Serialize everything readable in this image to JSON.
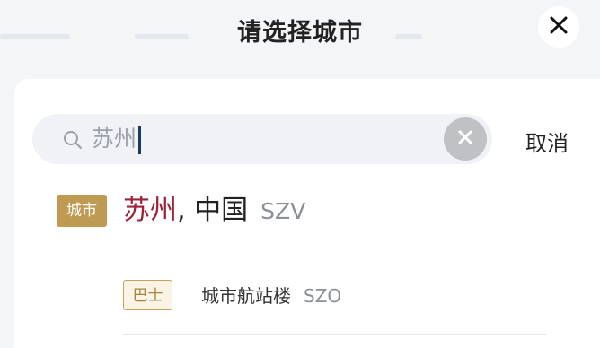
{
  "header": {
    "title": "请选择城市"
  },
  "icons": {
    "close": "close-icon",
    "search": "search-icon",
    "clear": "clear-icon"
  },
  "search": {
    "value": "苏州"
  },
  "cancel_label": "取消",
  "results": [
    {
      "badge": "城市",
      "name_highlight": "苏州",
      "name_rest": ", 中国",
      "code": "SZV"
    },
    {
      "badge": "巴士",
      "name": "城市航站楼",
      "code": "SZO"
    }
  ],
  "colors": {
    "accent_gold": "#bf9a52",
    "highlight_red": "#9c2237",
    "search_bg": "#f0f2f6"
  }
}
